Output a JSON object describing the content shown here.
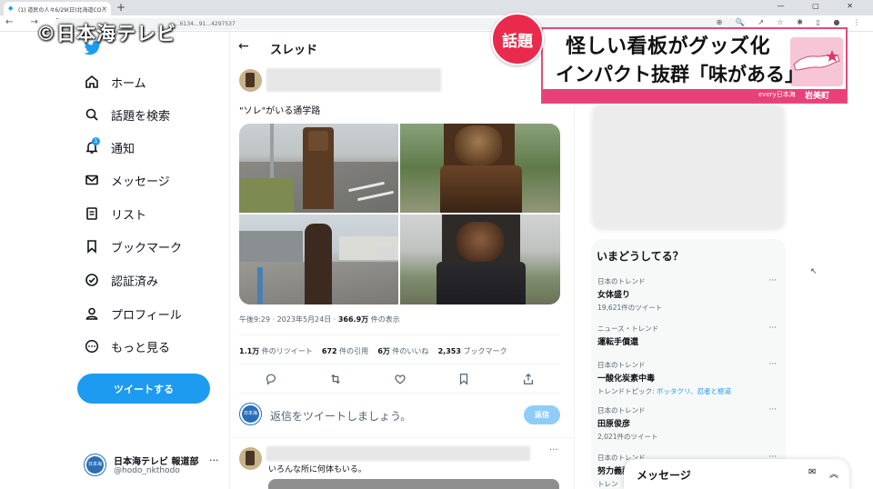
{
  "browser": {
    "tab_title": "(1) 道民の人々6/29(日)北海道CO...",
    "tab_close": "×",
    "new_tab": "+",
    "window_controls": "— ▢ ✕",
    "nav": "← → ↻",
    "url": "...6134...91...4297537",
    "extension_icons": "⊕ 🔍 ↗ ☆ ✱ ▯ ● ⋮"
  },
  "watermark": "©日本海テレビ",
  "sidebar": {
    "items": [
      {
        "label": "ホーム",
        "icon": "home-icon"
      },
      {
        "label": "話題を検索",
        "icon": "search-icon"
      },
      {
        "label": "通知",
        "icon": "bell-icon"
      },
      {
        "label": "メッセージ",
        "icon": "mail-icon"
      },
      {
        "label": "リスト",
        "icon": "list-icon"
      },
      {
        "label": "ブックマーク",
        "icon": "bookmark-icon"
      },
      {
        "label": "認証済み",
        "icon": "verified-icon"
      },
      {
        "label": "プロフィール",
        "icon": "person-icon"
      },
      {
        "label": "もっと見る",
        "icon": "more-circle-icon"
      }
    ],
    "notification_count": "1",
    "tweet_button": "ツイートする",
    "account": {
      "name": "日本海テレビ 報道部",
      "handle": "@hodo_nkthodo",
      "avatar_text": "日本海テレビ",
      "more": "···"
    }
  },
  "thread": {
    "header_title": "スレッド",
    "back": "←",
    "tweet_text": "\"ソレ\"がいる通学路",
    "meta": {
      "time": "午後9:29 · 2023年5月24日 · ",
      "views_value": "366.9万",
      "views_label": " 件の表示"
    },
    "stats": {
      "retweets_value": "1.1万",
      "retweets_label": " 件のリツイート",
      "quotes_value": "672",
      "quotes_label": " 件の引用",
      "likes_value": "6万",
      "likes_label": " 件のいいね",
      "bookmarks_value": "2,353",
      "bookmarks_label": " ブックマーク"
    },
    "reply_prompt": "返信をツイートしましょう。",
    "reply_button": "返信",
    "reply_avatar_text": "日本海テレビ",
    "reply2": {
      "text": "いろんな所に何体もいる。",
      "more": "···"
    }
  },
  "trends": {
    "title": "いまどうしてる？",
    "items": [
      {
        "category": "日本のトレンド",
        "name": "女体盛り",
        "count": "19,621件のツイート"
      },
      {
        "category": "ニュース・トレンド",
        "name": "運転手償還",
        "count": ""
      },
      {
        "category": "日本のトレンド",
        "name": "一酸化炭素中毒",
        "count_prefix": "トレンドトピック: ",
        "count_link": "ボッタクリ、忍者と極道"
      },
      {
        "category": "日本のトレンド",
        "name": "田原俊彦",
        "count": "2,021件のツイート"
      },
      {
        "category": "日本のトレンド",
        "name": "努力義務",
        "count": "トレン"
      }
    ],
    "more": "···"
  },
  "message_dock": {
    "title": "メッセージ",
    "compose_icon": "✉",
    "collapse_icon": "︽"
  },
  "caption": {
    "badge": "話題",
    "line1": "怪しい看板がグッズ化",
    "line2": "インパクト抜群「味がある」",
    "program": "every日本海",
    "location": "岩美町"
  },
  "colors": {
    "twitter_blue": "#1d9bf0",
    "badge_red": "#ea2a4c",
    "caption_pink": "#e9407a"
  }
}
